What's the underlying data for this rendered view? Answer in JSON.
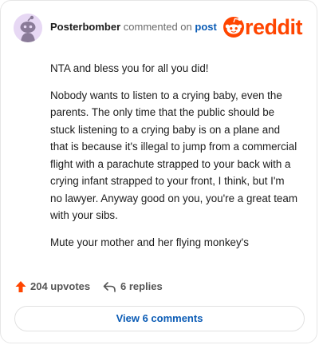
{
  "header": {
    "username": "Posterbomber",
    "action_text": "commented on",
    "post_link": "post"
  },
  "brand": {
    "wordmark": "reddit",
    "color": "#ff4500"
  },
  "comment": {
    "paragraphs": [
      "NTA and bless you for all you did!",
      "Nobody wants to listen to a crying baby, even the parents. The only time that the public should be stuck listening to a crying baby is on a plane and that is because it's illegal to jump from a commercial flight with a parachute strapped to your back with a crying infant strapped to your front, I think, but I'm no lawyer. Anyway good on you, you're a great team with your sibs.",
      "Mute your mother and her flying monkey's"
    ]
  },
  "actions": {
    "upvotes": "204 upvotes",
    "replies": "6 replies"
  },
  "view_comments": "View 6 comments",
  "icons": {
    "avatar": "snoo-avatar-icon",
    "logo": "reddit-snoo-icon",
    "upvote": "upvote-arrow-icon",
    "reply": "reply-arrow-icon"
  },
  "colors": {
    "accent": "#ff4500",
    "link": "#0a5bb5",
    "avatar_bg": "#e7d8f4"
  }
}
